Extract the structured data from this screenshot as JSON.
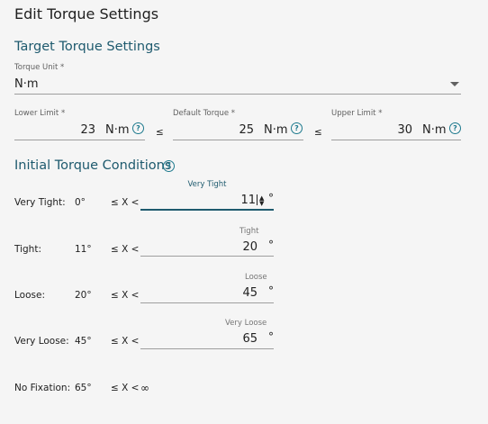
{
  "dialog": {
    "title": "Edit Torque Settings"
  },
  "target": {
    "section_title": "Target Torque Settings",
    "unit_label": "Torque Unit *",
    "unit_value": "N·m",
    "lower": {
      "label": "Lower Limit *",
      "value": "23",
      "unit": "N·m"
    },
    "default": {
      "label": "Default Torque *",
      "value": "25",
      "unit": "N·m"
    },
    "upper": {
      "label": "Upper Limit *",
      "value": "30",
      "unit": "N·m"
    },
    "leq": "≤"
  },
  "initial": {
    "section_title": "Initial Torque Conditions",
    "rows": [
      {
        "name": "Very Tight:",
        "start": "0°",
        "op": "≤ X <",
        "field_label": "Very Tight",
        "value": "11",
        "unit": "°"
      },
      {
        "name": "Tight:",
        "start": "11°",
        "op": "≤ X <",
        "field_label": "Tight",
        "value": "20",
        "unit": "°"
      },
      {
        "name": "Loose:",
        "start": "20°",
        "op": "≤ X <",
        "field_label": "Loose",
        "value": "45",
        "unit": "°"
      },
      {
        "name": "Very Loose:",
        "start": "45°",
        "op": "≤ X <",
        "field_label": "Very Loose",
        "value": "65",
        "unit": "°"
      }
    ],
    "no_fixation": {
      "name": "No Fixation:",
      "start": "65°",
      "op": "≤ X <",
      "end": "∞"
    }
  },
  "icons": {
    "help": "help-circle-icon",
    "dropdown": "chevron-down-icon",
    "spinner": "spinner-arrows-icon"
  },
  "colors": {
    "accent": "#1e5a6e",
    "background": "#f5f5f5"
  }
}
